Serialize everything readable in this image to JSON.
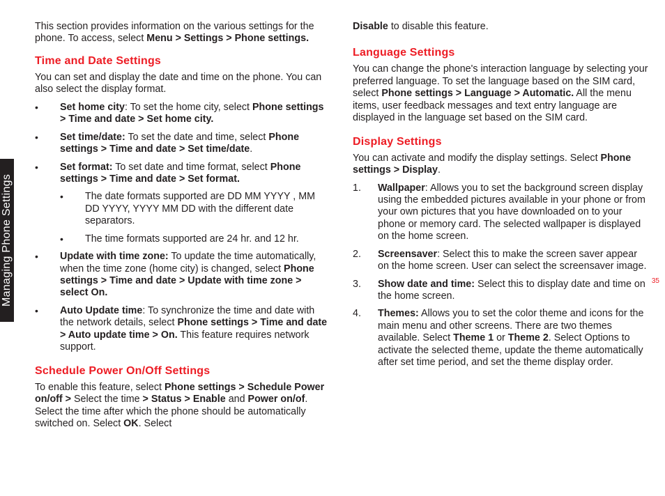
{
  "sidebar": {
    "label": "Managing Phone Settings"
  },
  "pageNumber": "35",
  "left": {
    "intro": {
      "pre": "This section provides information on the various settings for the phone. To access, select ",
      "bold": "Menu > Settings > Phone settings."
    },
    "timeDate": {
      "heading": "Time and Date Settings",
      "lead": "You can set and display the date and time on the phone. You can also select the display format.",
      "items": [
        {
          "bold": "Set home city",
          "sep": ": ",
          "text": "To set the home city, select ",
          "bold2": "Phone settings > Time and date > Set home city."
        },
        {
          "bold": "Set time/date:",
          "sep": " ",
          "text": "To set the date and time, select ",
          "bold2": "Phone settings > Time and date > Set time/date",
          "after": "."
        },
        {
          "bold": "Set format:",
          "sep": " ",
          "text": "To set date and time format, select ",
          "bold2": "Phone settings > Time and date > Set format.",
          "sub": [
            "The date formats supported are DD MM YYYY , MM DD YYYY, YYYY MM DD with the different date separators.",
            "The time formats supported are 24 hr. and 12 hr."
          ]
        },
        {
          "bold": "Update with time zone:",
          "sep": " ",
          "text": "To update the time automatically, when the time zone (home city) is changed, select ",
          "bold2": "Phone settings > Time and date > Update with time zone > select On."
        },
        {
          "bold": "Auto Update time",
          "sep": ": ",
          "text": "To synchronize the time and date with the network details, select ",
          "bold2": "Phone settings > Time and date > Auto update time > On.",
          "after": " This feature requires network support."
        }
      ]
    },
    "schedule": {
      "heading": "Schedule Power On/Off Settings",
      "p1a": "To enable this feature, select ",
      "p1b": "Phone settings > Schedule Power on/off >",
      "p1c": " Select the time ",
      "p1d": "> Status > Enable",
      "p1e": " and ",
      "p1f": "Power on/of",
      "p1g": ". Select the time after which the phone should be automatically switched on. Select ",
      "p1h": "OK",
      "p1i": ". Select "
    }
  },
  "right": {
    "disable": {
      "b": "Disable",
      "t": " to disable this feature."
    },
    "language": {
      "heading": "Language Settings",
      "p1a": "You can change the phone's interaction language by selecting your preferred language. To set the language based on the SIM card, select ",
      "p1b": "Phone settings > Language > Automatic.",
      "p1c": " All the menu items, user feedback messages and text entry language are displayed in the language set based on the SIM card."
    },
    "display": {
      "heading": "Display Settings",
      "leadA": "You can activate and modify the display settings. Select ",
      "leadB": "Phone settings > Display",
      "leadC": ".",
      "items": [
        {
          "bold": "Wallpaper",
          "sep": ": ",
          "text": "Allows you to set the background screen display using the embedded pictures available in your phone or from your own pictures that you have downloaded on to your phone or memory card. The selected wallpaper is displayed on the home screen."
        },
        {
          "bold": "Screensaver",
          "sep": ": ",
          "text": "Select this to make the screen saver appear on the home screen. User can select the screensaver image."
        },
        {
          "bold": "Show date and time:",
          "sep": " ",
          "text": "Select this to display date and time on the home screen."
        },
        {
          "bold": "Themes:",
          "sep": " ",
          "text": "Allows you to set the color theme and icons for the main menu and other screens. There are two themes available. Select ",
          "bold2": "Theme 1",
          "mid": " or ",
          "bold3": "Theme 2",
          "after": ". Select Options to activate the selected theme, update the theme automatically after set time period, and set the theme display order."
        }
      ]
    }
  }
}
